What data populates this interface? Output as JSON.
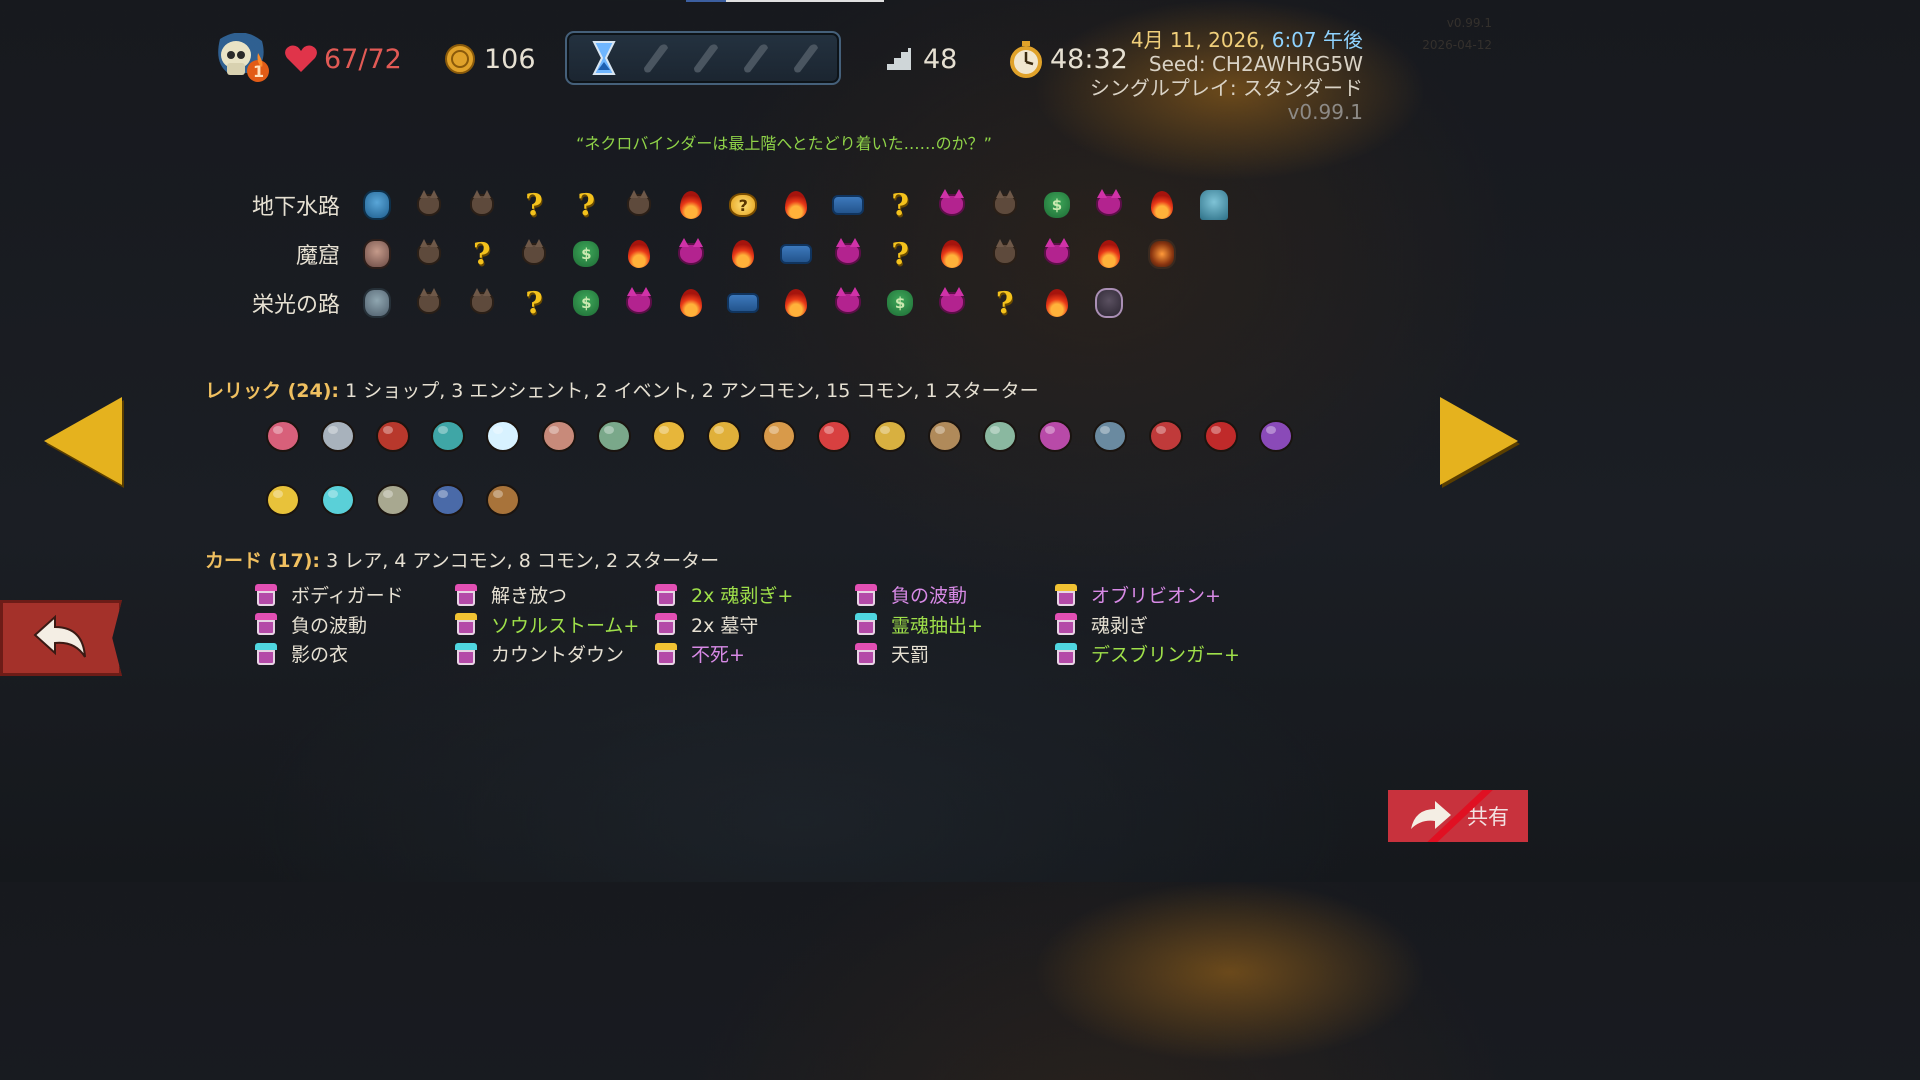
{
  "hud": {
    "ascension": "1",
    "hp": "67/72",
    "gold": "106",
    "floor": "48",
    "timer": "48:32",
    "date": "4月 11, 2026",
    "time": "6:07 午後",
    "seed": "Seed: CH2AWHRG5W",
    "mode": "シングルプレイ: スタンダード",
    "version": "v0.99.1",
    "faint_version": "v0.99.1",
    "faint_date": "2026-04-12"
  },
  "quote": "“ネクロバインダーは最上階へとたどり着いた……のか？”",
  "acts": [
    {
      "name": "地下水路",
      "nodes": [
        "boss-b1",
        "monster",
        "monster",
        "unknown",
        "unknown",
        "monster",
        "rest",
        "ancient",
        "rest",
        "treasure",
        "unknown",
        "elite",
        "monster",
        "shop",
        "elite",
        "rest",
        "boss-b2"
      ]
    },
    {
      "name": "魔窟",
      "nodes": [
        "boss-b3",
        "monster",
        "unknown",
        "monster",
        "shop",
        "rest",
        "elite",
        "rest",
        "treasure",
        "elite",
        "unknown",
        "rest",
        "monster",
        "elite",
        "rest",
        "boss-b4"
      ]
    },
    {
      "name": "栄光の路",
      "nodes": [
        "boss-b5",
        "monster",
        "monster",
        "unknown",
        "shop",
        "elite",
        "rest",
        "treasure",
        "rest",
        "elite",
        "shop",
        "elite",
        "unknown",
        "rest",
        "boss-b6"
      ]
    }
  ],
  "relics": {
    "label": "レリック (24):",
    "summary": "1 ショップ,  3 エンシェント, 2 イベント, 2 アンコモン, 15 コモン, 1 スターター",
    "items": [
      "heart-coral",
      "scissors",
      "red-mailbox",
      "teal-bowl",
      "snowflake",
      "feather",
      "tea-kettle",
      "golden-crown",
      "golden-vajra",
      "origami",
      "lipstick",
      "gold-ring",
      "backpack",
      "teapot",
      "purple-potion",
      "tag",
      "red-cushion",
      "red-potion",
      "purple-slug",
      "sunflower",
      "prism",
      "newtons-cradle",
      "whetstone",
      "wood-totem"
    ]
  },
  "cards": {
    "label": "カード (17):",
    "summary": "3 レア, 4 アンコモン, 8 コモン, 2 スターター",
    "items": [
      {
        "name": "ボディガード",
        "style": "normal",
        "top": "#e24fb3"
      },
      {
        "name": "解き放つ",
        "style": "normal",
        "top": "#e24fb3"
      },
      {
        "name": "2x 魂剥ぎ+",
        "style": "upg",
        "top": "#e24fb3"
      },
      {
        "name": "負の波動",
        "style": "rare",
        "top": "#e24fb3"
      },
      {
        "name": "オブリビオン+",
        "style": "rare",
        "top": "#f1c232"
      },
      {
        "name": "負の波動",
        "style": "normal",
        "top": "#e24fb3"
      },
      {
        "name": "ソウルストーム+",
        "style": "upg",
        "top": "#f1c232"
      },
      {
        "name": "2x 墓守",
        "style": "normal",
        "top": "#e24fb3"
      },
      {
        "name": "霊魂抽出+",
        "style": "upg",
        "top": "#4fd6e0"
      },
      {
        "name": "魂剥ぎ",
        "style": "normal",
        "top": "#e24fb3"
      },
      {
        "name": "影の衣",
        "style": "normal",
        "top": "#4fd6e0"
      },
      {
        "name": "カウントダウン",
        "style": "normal",
        "top": "#4fd6e0"
      },
      {
        "name": "不死+",
        "style": "rare",
        "top": "#f1c232"
      },
      {
        "name": "天罰",
        "style": "normal",
        "top": "#e24fb3"
      },
      {
        "name": "デスブリンガー+",
        "style": "upg",
        "top": "#4fd6e0"
      }
    ]
  },
  "buttons": {
    "share": "共有"
  },
  "colors": {
    "accent_gold": "#e5b21e",
    "hp_red": "#e25a55",
    "upgraded_green": "#9fe04a",
    "rare_purple": "#d88ae6"
  }
}
